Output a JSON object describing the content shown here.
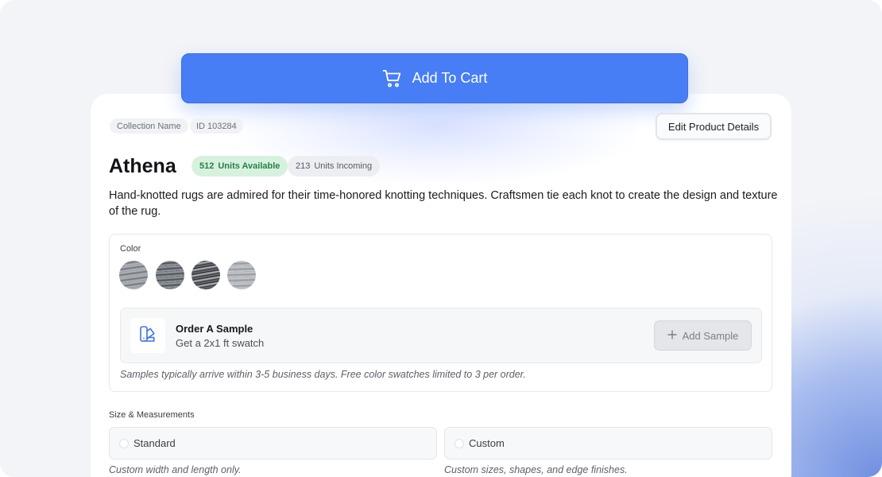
{
  "cta": {
    "add_to_cart_label": "Add To Cart",
    "color": "#477EF6",
    "icon": "cart-icon"
  },
  "product": {
    "collection_chip": "Collection Name",
    "id_chip": "ID 103284",
    "edit_button_label": "Edit Product Details",
    "name": "Athena",
    "available": {
      "count": "512",
      "label": "Units Available"
    },
    "incoming": {
      "count": "213",
      "label": "Units Incoming"
    },
    "description": "Hand-knotted rugs are admired for their time-honored knotting techniques. Craftsmen tie each knot to create the design and texture of the rug."
  },
  "color_section": {
    "label": "Color",
    "swatches": [
      "swatch-1",
      "swatch-2",
      "swatch-3",
      "swatch-4"
    ],
    "sample": {
      "icon": "sample-swatch-icon",
      "title": "Order A Sample",
      "subtitle": "Get a 2x1 ft swatch",
      "button_label": "Add Sample"
    },
    "note": "Samples typically arrive within 3-5 business days. Free color swatches limited to 3 per order."
  },
  "size_section": {
    "label": "Size & Measurements",
    "options": [
      {
        "label": "Standard",
        "note": "Custom width and length only."
      },
      {
        "label": "Custom",
        "note": "Custom sizes, shapes, and edge finishes."
      }
    ]
  },
  "colors": {
    "accent": "#477EF6",
    "available_badge_bg": "#D6F2DF",
    "available_badge_text": "#27804A"
  }
}
